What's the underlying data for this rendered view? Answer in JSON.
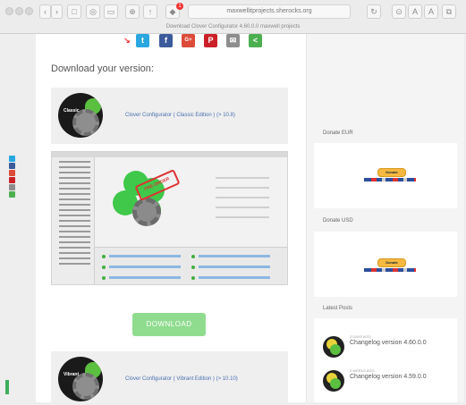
{
  "browser": {
    "address": "maxwellitprojects.sherocks.org",
    "tab_title": "Download Clover Configurator 4.60.0.0 maxwell projects",
    "notification_count": "1",
    "nav": [
      "‹",
      "›"
    ]
  },
  "page": {
    "heading": "Download your version:",
    "share_icons": [
      "twitter",
      "facebook",
      "google-plus",
      "pinterest",
      "email",
      "share"
    ],
    "classic": {
      "logo_text": "Classic",
      "title": "Clover Configurator ( Classic Edition ) (> 10.8)"
    },
    "screenshot_stamp": "PRE-ORDER",
    "download_label": "DOWNLOAD",
    "vibrant": {
      "logo_text": "Vibrant",
      "title": "Clover Configurator ( Vibrant Edition ) (> 10.10)"
    }
  },
  "sidebar": {
    "donate_eur_label": "Donate EUR",
    "donate_usd_label": "Donate USD",
    "donate_button": "Donate",
    "latest_posts_label": "Latest Posts",
    "posts": [
      {
        "date": "2 DAYS AGO",
        "title": "Changelog version 4.60.0.0"
      },
      {
        "date": "2 WEEKS AGO",
        "title": "Changelog version 4.59.0.0"
      }
    ]
  },
  "colors": {
    "link": "#4a6fb0",
    "download_button": "#8fdc8f",
    "twitter": "#2aa7e0",
    "facebook": "#3b5b9a",
    "google_plus": "#dd4b39",
    "pinterest": "#cb2027",
    "email": "#8d8d8d",
    "share": "#4caf50"
  }
}
